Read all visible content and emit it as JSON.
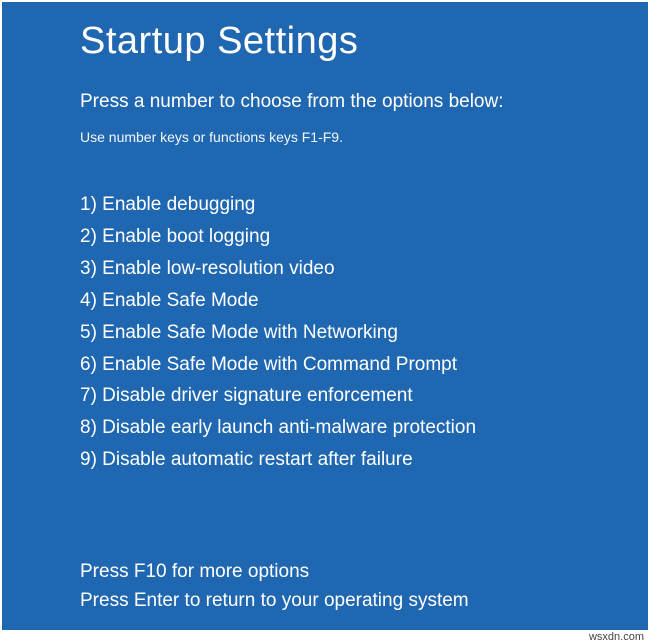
{
  "title": "Startup Settings",
  "subtitle": "Press a number to choose from the options below:",
  "hint": "Use number keys or functions keys F1-F9.",
  "options": [
    "1) Enable debugging",
    "2) Enable boot logging",
    "3) Enable low-resolution video",
    "4) Enable Safe Mode",
    "5) Enable Safe Mode with Networking",
    "6) Enable Safe Mode with Command Prompt",
    "7) Disable driver signature enforcement",
    "8) Disable early launch anti-malware protection",
    "9) Disable automatic restart after failure"
  ],
  "footer": {
    "more": "Press F10 for more options",
    "return": "Press Enter to return to your operating system"
  },
  "watermark": "wsxdn.com"
}
